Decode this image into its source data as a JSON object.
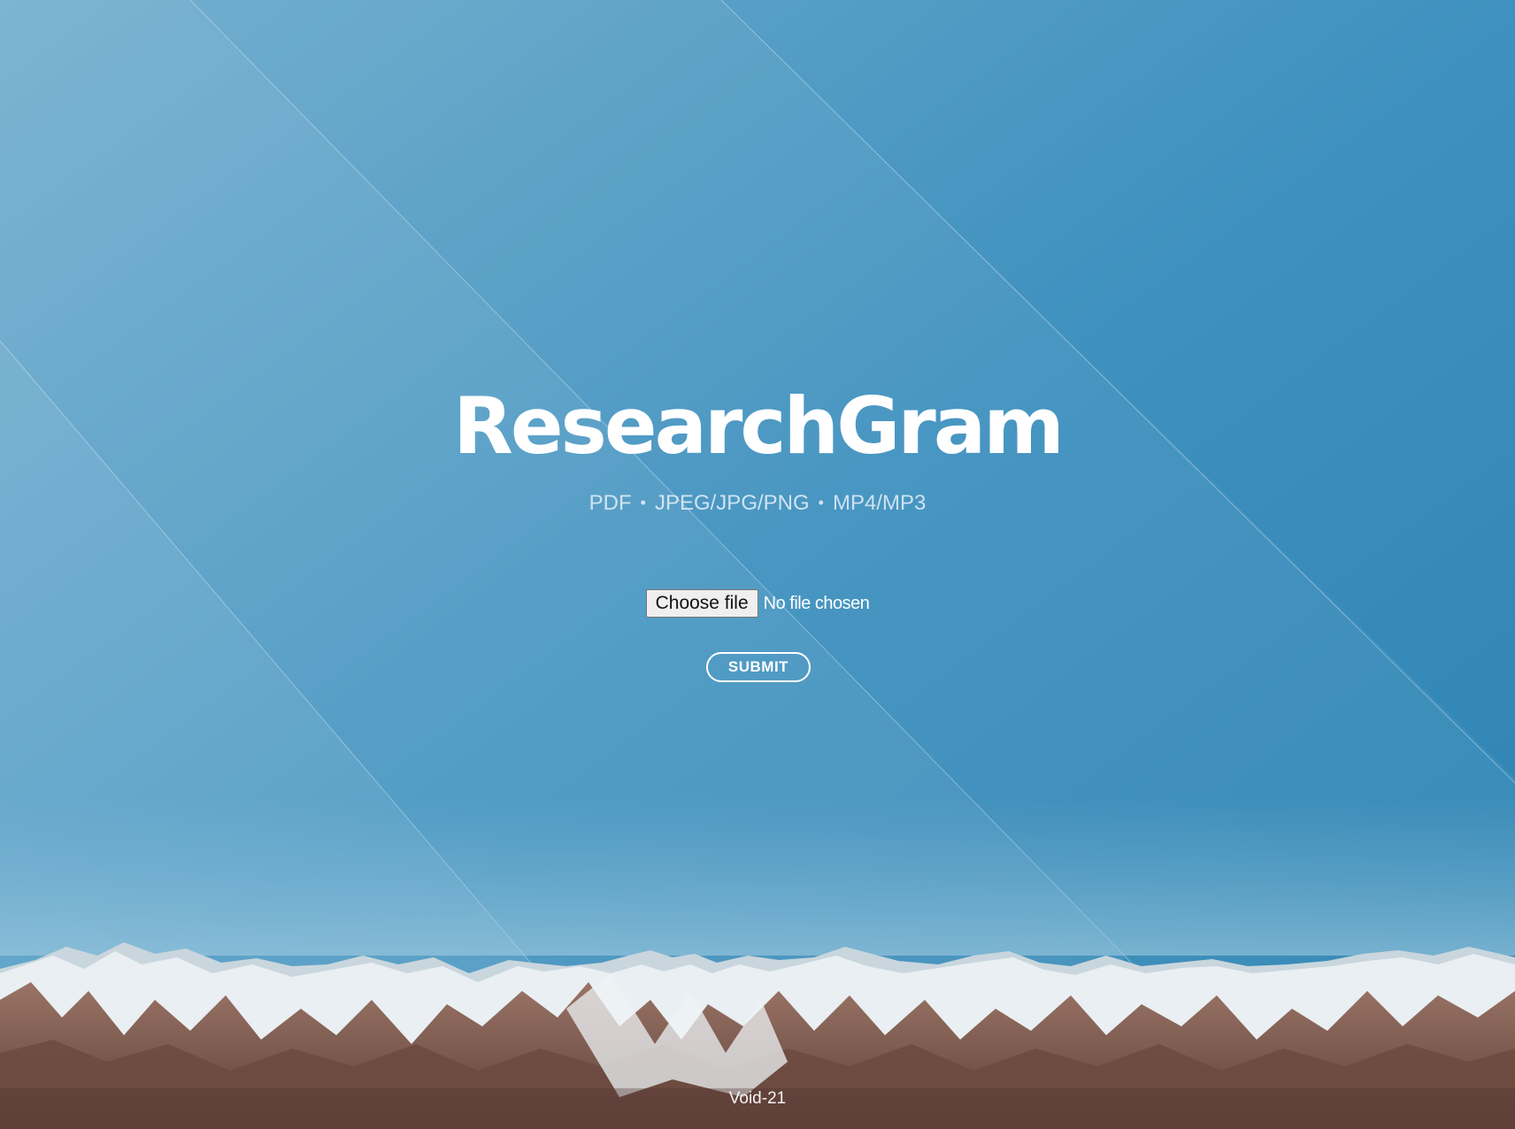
{
  "app": {
    "title": "ResearchGram",
    "formats": [
      "PDF",
      "JPEG/JPG/PNG",
      "MP4/MP3"
    ],
    "separator": "•"
  },
  "upload": {
    "choose_label": "Choose file",
    "status": "No file chosen",
    "submit_label": "SUBMIT"
  },
  "footer": {
    "credit": "Void-21"
  },
  "colors": {
    "sky_light": "#8fc0d8",
    "sky_dark": "#2f85b4",
    "text": "#ffffff"
  }
}
